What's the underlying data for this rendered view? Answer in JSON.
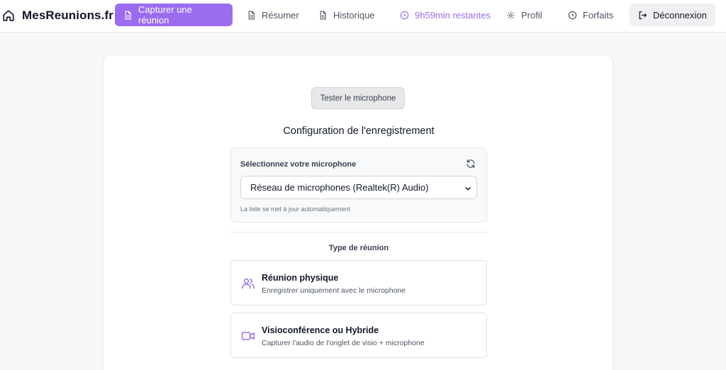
{
  "header": {
    "brand": "MesReunions.fr",
    "nav": {
      "capture": "Capturer une réunion",
      "resumer": "Résumer",
      "historique": "Historique",
      "time_remaining": "9h59min restantes",
      "profil": "Profil",
      "forfaits": "Forfaits",
      "logout": "Déconnexion"
    }
  },
  "main": {
    "test_button": "Tester le microphone",
    "section_title": "Configuration de l'enregistrement",
    "microphone": {
      "label": "Sélectionnez votre microphone",
      "selected": "Réseau de microphones (Realtek(R) Audio)",
      "hint": "La liste se met à jour automatiquement"
    },
    "meeting_type": {
      "label": "Type de réunion",
      "options": [
        {
          "title": "Réunion physique",
          "description": "Enregistrer uniquement avec le microphone",
          "icon": "users-icon"
        },
        {
          "title": "Visioconférence ou Hybride",
          "description": "Capturer l'audio de l'onglet de visio + microphone",
          "icon": "video-icon"
        }
      ]
    }
  },
  "colors": {
    "accent": "#9c6cf0",
    "accent_text": "#9b6ee8"
  }
}
